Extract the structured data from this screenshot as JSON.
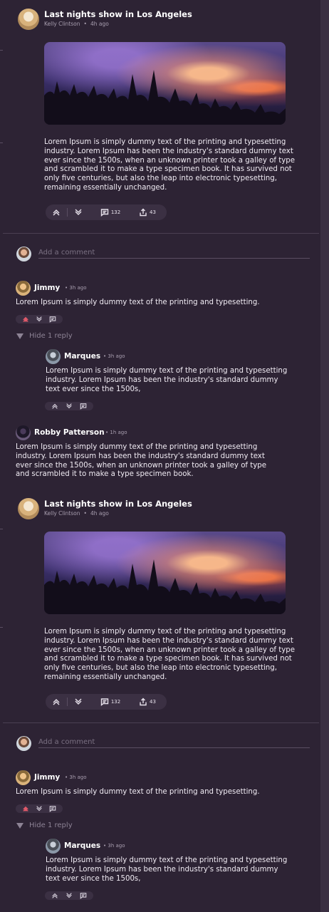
{
  "posts": [
    {
      "title": "Last nights show in Los Angeles",
      "author": "Kelly Clintson",
      "time": "4h ago",
      "body": "Lorem Ipsum is simply dummy text of the printing and typesetting industry. Lorem Ipsum has been the industry's standard dummy text ever since the 1500s, when an unknown printer took a galley of type and scrambled it to make a type specimen book. It has survived not only five centuries, but also the leap into electronic typesetting, remaining essentially unchanged.",
      "comments_count": "132",
      "shares_count": "43",
      "comment_placeholder": "Add a comment",
      "comments": [
        {
          "name": "Jimmy",
          "time": "3h ago",
          "text": "Lorem Ipsum is simply dummy text of the printing and typesetting."
        }
      ],
      "hide_reply_label": "Hide 1 reply",
      "reply": {
        "name": "Marques",
        "time": "3h ago",
        "text": "Lorem Ipsum is simply dummy text of the printing and typesetting industry. Lorem Ipsum has been the industry's standard dummy text ever since the 1500s,"
      },
      "extra_comment": {
        "name": "Robby Patterson",
        "time": "1h ago",
        "text": "Lorem Ipsum is simply dummy text of the printing and typesetting industry. Lorem Ipsum has been the industry's standard dummy text ever since the 1500s, when an unknown printer took a galley of type and scrambled it to make a type specimen book."
      }
    },
    {
      "title": "Last nights show in Los Angeles",
      "author": "Kelly Clintson",
      "time": "4h ago",
      "body": "Lorem Ipsum is simply dummy text of the printing and typesetting industry. Lorem Ipsum has been the industry's standard dummy text ever since the 1500s, when an unknown printer took a galley of type and scrambled it to make a type specimen book. It has survived not only five centuries, but also the leap into electronic typesetting, remaining essentially unchanged.",
      "comments_count": "132",
      "shares_count": "43",
      "comment_placeholder": "Add a comment",
      "comments": [
        {
          "name": "Jimmy",
          "time": "3h ago",
          "text": "Lorem Ipsum is simply dummy text of the printing and typesetting."
        }
      ],
      "hide_reply_label": "Hide 1 reply",
      "reply": {
        "name": "Marques",
        "time": "3h ago",
        "text": "Lorem Ipsum is simply dummy text of the printing and typesetting industry. Lorem Ipsum has been the industry's standard dummy text ever since the 1500s,"
      }
    }
  ],
  "colors": {
    "background": "#2d2334",
    "upvote_active": "#e05a6a"
  },
  "icons": [
    "upvote-icon",
    "downvote-icon",
    "comment-icon",
    "share-icon"
  ]
}
